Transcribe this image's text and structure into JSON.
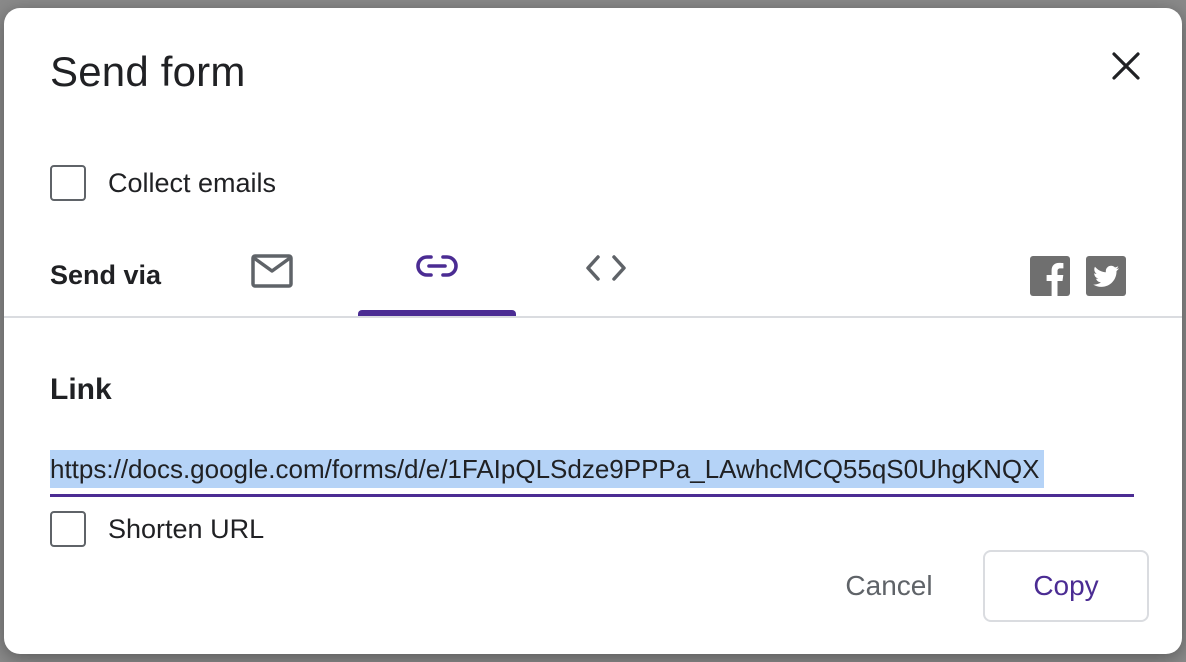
{
  "dialog": {
    "title": "Send form",
    "collect_emails_label": "Collect emails",
    "send_via_label": "Send via",
    "tabs": [
      {
        "icon": "mail-icon",
        "selected": false
      },
      {
        "icon": "link-icon",
        "selected": true
      },
      {
        "icon": "embed-code-icon",
        "selected": false
      }
    ],
    "social": [
      "facebook-icon",
      "twitter-icon"
    ],
    "link_heading": "Link",
    "link_url": "https://docs.google.com/forms/d/e/1FAIpQLSdze9PPPa_LAwhcMCQ55qS0UhgKNQX",
    "shorten_url_label": "Shorten URL",
    "cancel_label": "Cancel",
    "copy_label": "Copy"
  },
  "colors": {
    "accent": "#4b2c93",
    "selection": "#b5d3f7",
    "icon_gray": "#5f6368",
    "social_gray": "#6f6f6f"
  }
}
